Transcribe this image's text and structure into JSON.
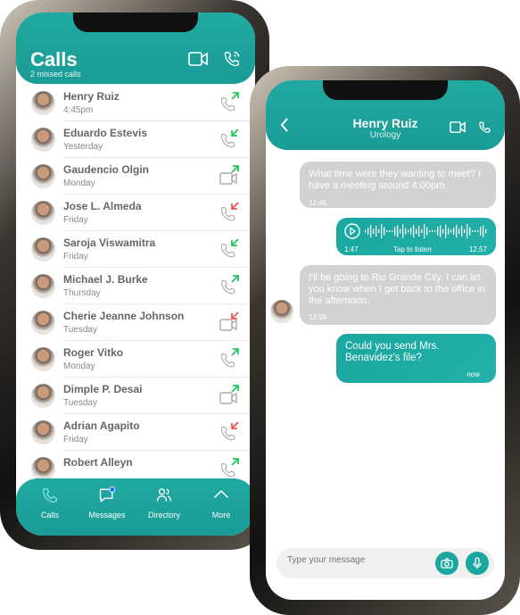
{
  "calls_screen": {
    "title": "Calls",
    "subtitle": "2 missed calls",
    "header_icons": [
      "video-icon",
      "phone-icon"
    ],
    "items": [
      {
        "name": "Henry Ruiz",
        "time": "4:45pm",
        "type": "phone",
        "direction": "outgoing"
      },
      {
        "name": "Eduardo Estevis",
        "time": "Yesterday",
        "type": "phone",
        "direction": "incoming"
      },
      {
        "name": "Gaudencio Olgin",
        "time": "Monday",
        "type": "video",
        "direction": "outgoing"
      },
      {
        "name": "Jose L. Almeda",
        "time": "Friday",
        "type": "phone",
        "direction": "missed"
      },
      {
        "name": "Saroja Viswamitra",
        "time": "Friday",
        "type": "phone",
        "direction": "incoming"
      },
      {
        "name": "Michael J. Burke",
        "time": "Thursday",
        "type": "phone",
        "direction": "outgoing"
      },
      {
        "name": "Cherie Jeanne Johnson",
        "time": "Tuesday",
        "type": "video",
        "direction": "missed"
      },
      {
        "name": "Roger Vitko",
        "time": "Monday",
        "type": "phone",
        "direction": "outgoing"
      },
      {
        "name": "Dimple P. Desai",
        "time": "Tuesday",
        "type": "video",
        "direction": "outgoing"
      },
      {
        "name": "Adrian Agapito",
        "time": "Friday",
        "type": "phone",
        "direction": "missed"
      },
      {
        "name": "Robert Alleyn",
        "time": "",
        "type": "phone",
        "direction": "outgoing"
      }
    ],
    "nav": [
      {
        "label": "Calls",
        "icon": "phone-icon",
        "active": true
      },
      {
        "label": "Messages",
        "icon": "chat-icon",
        "badge": true
      },
      {
        "label": "Directory",
        "icon": "users-icon"
      },
      {
        "label": "More",
        "icon": "chevron-up-icon"
      }
    ]
  },
  "chat_screen": {
    "contact": "Henry Ruiz",
    "department": "Urology",
    "messages": [
      {
        "text": "What time were they wanting to meet? I have a meeting around 4:00pm.",
        "time": "12:45",
        "side": "received"
      },
      {
        "voice": true,
        "duration": "1:47",
        "hint": "Tap to listen",
        "time": "12:57",
        "side": "sent"
      },
      {
        "text": "I'll be going to Rio Grande City. I can let you know when I get back to the office in the afternoon.",
        "time": "12:59",
        "side": "received"
      },
      {
        "text": "Could you send Mrs. Benavidez's file?",
        "time": "now",
        "side": "sent"
      }
    ],
    "input_placeholder": "Type your message"
  },
  "colors": {
    "accent": "#1aa7a0",
    "green": "#22c55e",
    "red": "#ef5350",
    "badge": "#1e6bff"
  }
}
